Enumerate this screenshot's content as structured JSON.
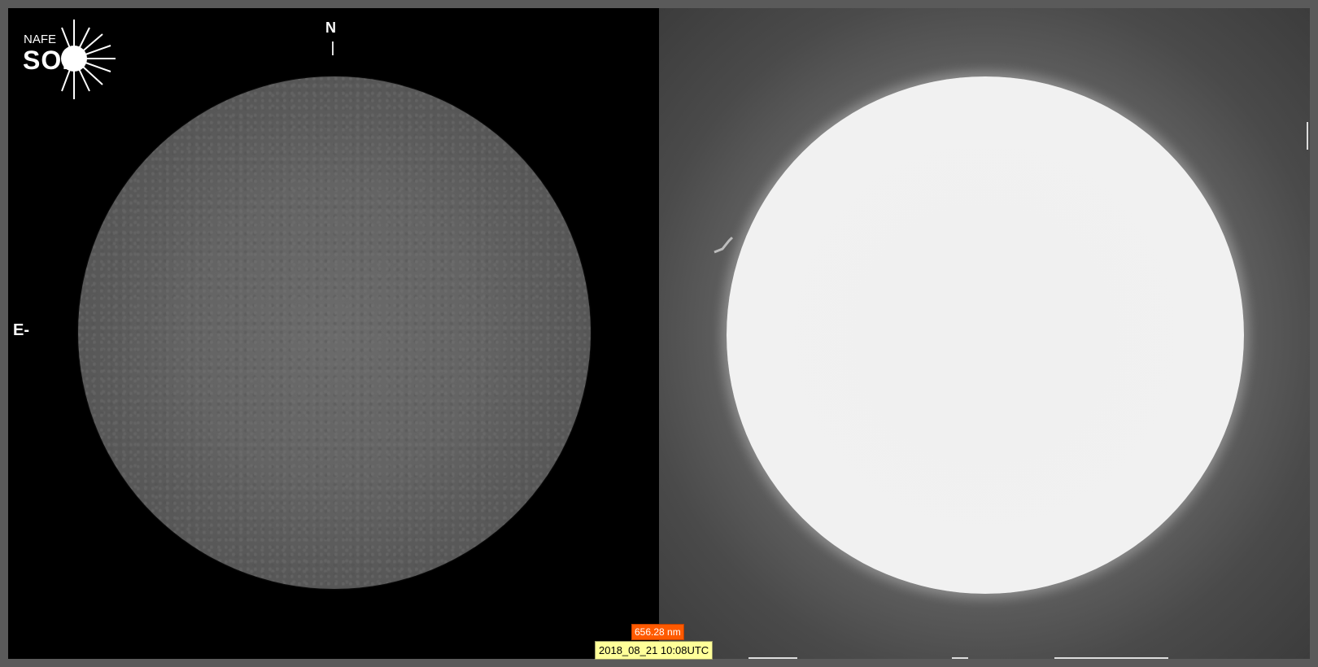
{
  "logo": {
    "line1": "NAFE",
    "line2": "SOP"
  },
  "compass": {
    "north": "N",
    "east": "E-"
  },
  "overlay": {
    "wavelength": "656.28 nm",
    "timestamp": "2018_08_21 10:08UTC"
  },
  "colors": {
    "frame": "#5a5a5a",
    "left_background": "#000000",
    "wavelength_badge": "#ff5a00",
    "timestamp_badge": "#ffff99"
  },
  "panels": [
    {
      "name": "left-panel",
      "content": "solar disk"
    },
    {
      "name": "right-panel",
      "content": "solar disk overexposed"
    }
  ]
}
